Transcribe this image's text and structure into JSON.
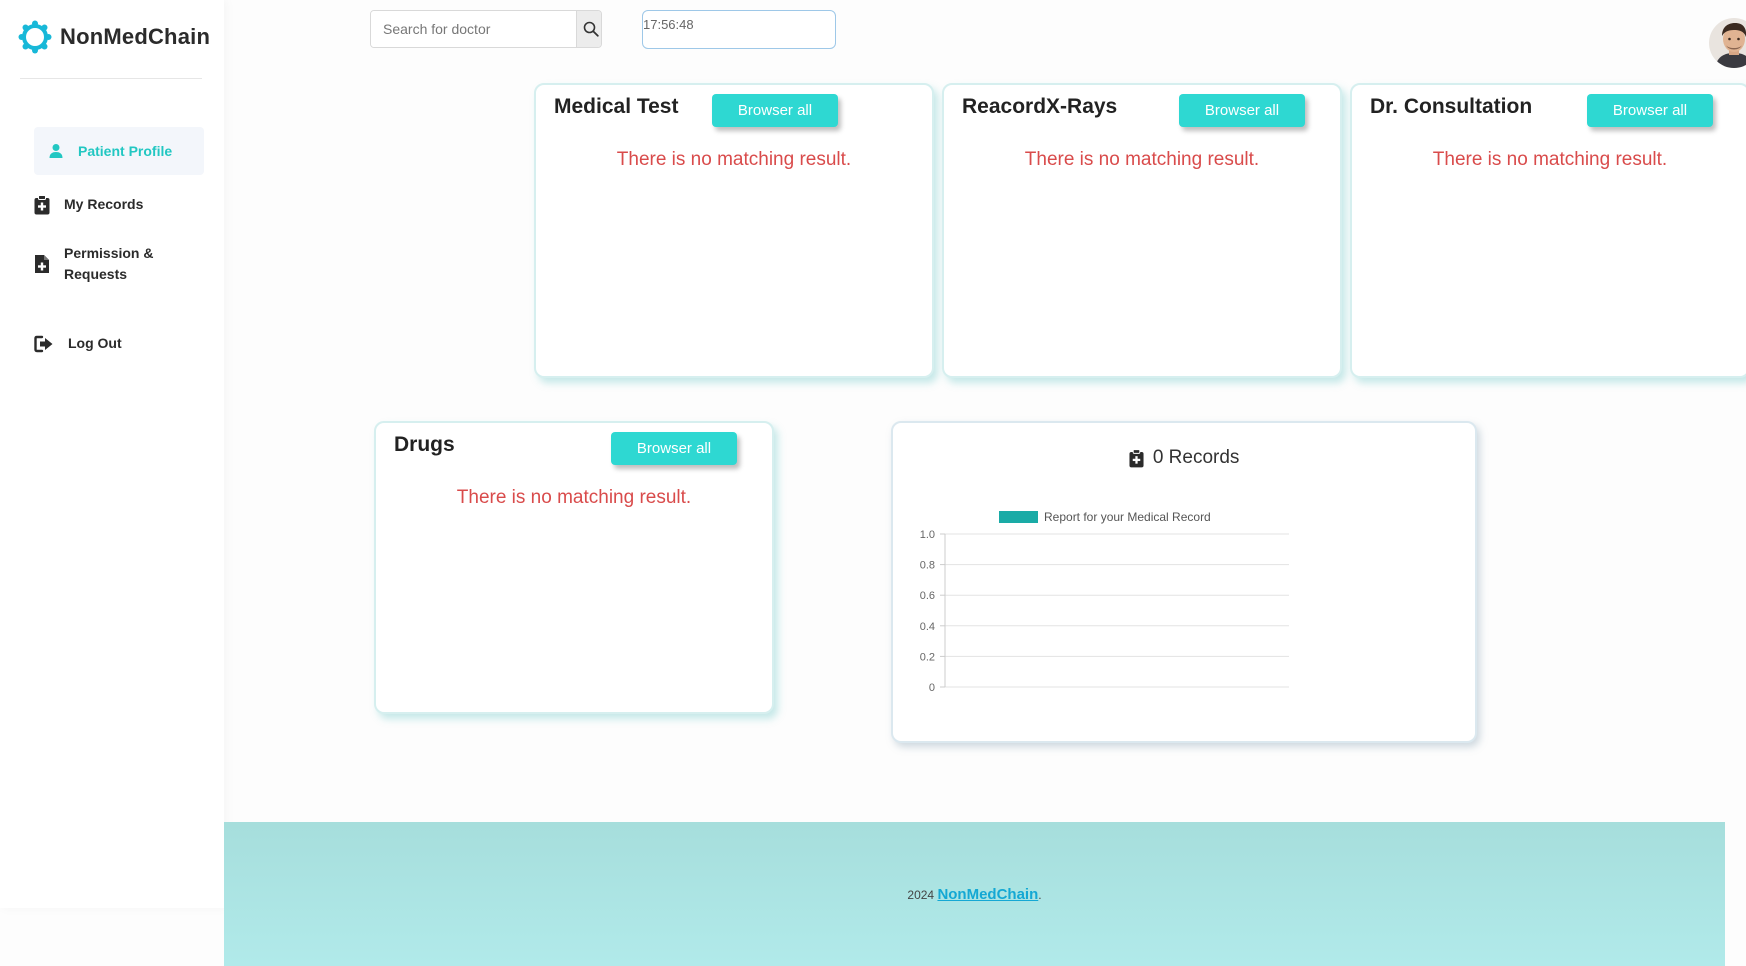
{
  "app": {
    "brand_name": "NonMedChain"
  },
  "sidebar": {
    "items": [
      {
        "label": "Patient Profile",
        "icon": "user-icon",
        "active": true
      },
      {
        "label": "My Records",
        "icon": "clipboard-plus-icon",
        "active": false
      },
      {
        "label": "Permission & Requests",
        "icon": "file-plus-icon",
        "active": false
      },
      {
        "label": "Log Out",
        "icon": "logout-icon",
        "active": false
      }
    ]
  },
  "header": {
    "search_placeholder": "Search for doctor",
    "search_value": "",
    "clock": "17:56:48"
  },
  "cards": [
    {
      "title": "Medical Test",
      "button_label": "Browser all",
      "empty_message": "There is no matching result."
    },
    {
      "title": "ReacordX-Rays",
      "button_label": "Browser all",
      "empty_message": "There is no matching result."
    },
    {
      "title": "Dr. Consultation",
      "button_label": "Browser all",
      "empty_message": "There is no matching result."
    },
    {
      "title": "Drugs",
      "button_label": "Browser all",
      "empty_message": "There is no matching result."
    }
  ],
  "records": {
    "heading": "0 Records",
    "icon": "clipboard-plus-icon"
  },
  "chart_data": {
    "type": "bar",
    "title": "",
    "xlabel": "",
    "ylabel": "",
    "categories": [],
    "series": [
      {
        "name": "Report for your Medical Record",
        "values": [],
        "color": "#1aaba6"
      }
    ],
    "ylim": [
      0,
      1.0
    ],
    "y_ticks": [
      "0",
      "0.2",
      "0.4",
      "0.6",
      "0.8",
      "1.0"
    ],
    "grid": true,
    "legend": "top"
  },
  "footer": {
    "year": "2024",
    "link_text": "NonMedChain",
    "suffix": "."
  },
  "colors": {
    "accent": "#2ed8d2",
    "active_nav_text": "#22c7c2",
    "error_text": "#d94b4b",
    "footer_bg": "#a6dedc",
    "footer_link": "#14a8d4"
  }
}
